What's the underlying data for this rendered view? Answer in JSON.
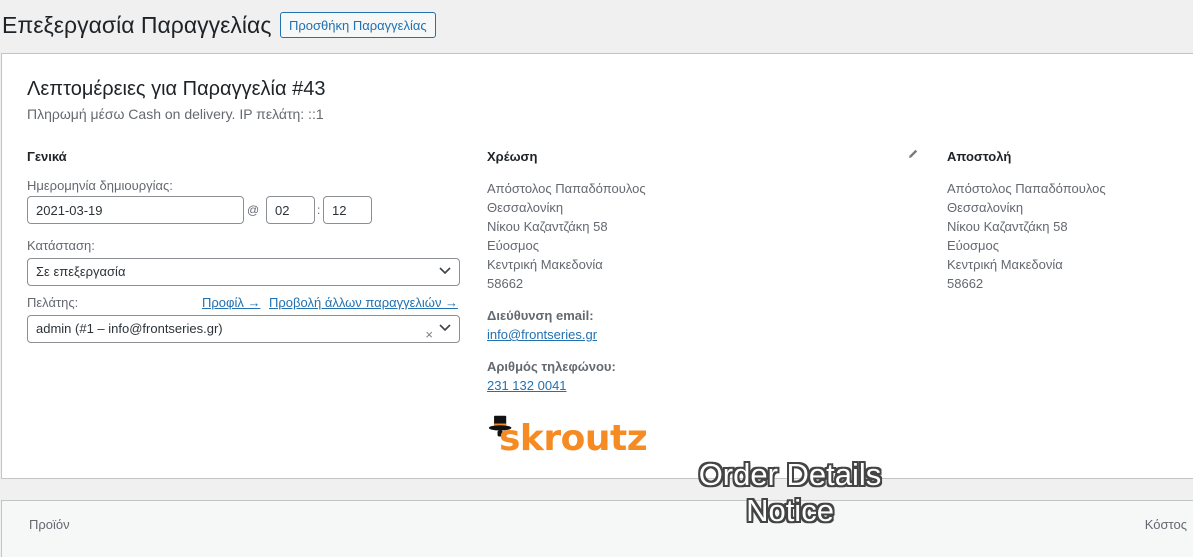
{
  "header": {
    "title": "Επεξεργασία Παραγγελίας",
    "add_button": "Προσθήκη Παραγγελίας"
  },
  "order": {
    "heading": "Λεπτομέρειες για Παραγγελία #43",
    "subheading": "Πληρωμή μέσω Cash on delivery. IP πελάτη: ::1"
  },
  "general": {
    "title": "Γενικά",
    "date_label": "Ημερομηνία δημιουργίας:",
    "date_value": "2021-03-19",
    "at": "@",
    "hour": "02",
    "colon": ":",
    "minute": "12",
    "status_label": "Κατάσταση:",
    "status_value": "Σε επεξεργασία",
    "customer_label": "Πελάτης:",
    "profile_link": "Προφίλ →",
    "other_orders_link": "Προβολή άλλων παραγγελιών →",
    "customer_value": "admin (#1 – info@frontseries.gr)",
    "clear": "×"
  },
  "billing": {
    "title": "Χρέωση",
    "name": "Απόστολος Παπαδόπουλος",
    "city": "Θεσσαλονίκη",
    "street": "Νίκου Καζαντζάκη 58",
    "area": "Εύοσμος",
    "region": "Κεντρική Μακεδονία",
    "postcode": "58662",
    "email_label": "Διεύθυνση email:",
    "email": "info@frontseries.gr",
    "phone_label": "Αριθμός τηλεφώνου:",
    "phone": "231 132 0041",
    "logo_text": "skroutz"
  },
  "shipping": {
    "title": "Αποστολή",
    "name": "Απόστολος Παπαδόπουλος",
    "city": "Θεσσαλονίκη",
    "street": "Νίκου Καζαντζάκη 58",
    "area": "Εύοσμος",
    "region": "Κεντρική Μακεδονία",
    "postcode": "58662"
  },
  "overlay": {
    "line1": "Order Details",
    "line2": "Notice"
  },
  "items": {
    "product_col": "Προϊόν",
    "cost_col": "Κόστος"
  },
  "colors": {
    "accent": "#2271b1",
    "skroutz_orange": "#f68b24"
  }
}
